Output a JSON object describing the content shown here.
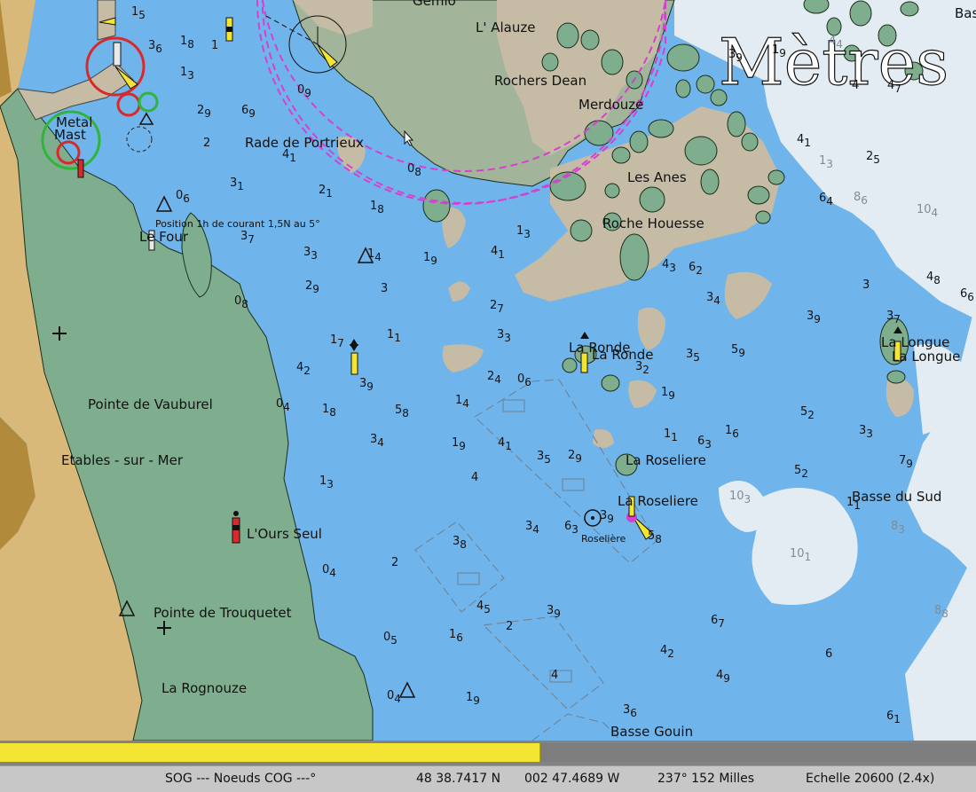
{
  "watermark": "Mètres",
  "places": {
    "gemlo": "Gemlo",
    "alauze": "L' Alauze",
    "rochers_dean": "Rochers Dean",
    "merdouze": "Merdouze",
    "rade": "Rade de Portrieux",
    "les_anes": "Les Anes",
    "roche_houesse": "Roche Houesse",
    "metal_mast_1": "Metal",
    "metal_mast_2": "Mast",
    "le_four": "Le Four",
    "courant": "Position 1h de courant 1,5N au 5°",
    "la_ronde_a": "La Ronde",
    "la_ronde_b": "La Ronde",
    "la_longue_a": "La Longue",
    "la_longue_b": "La Longue",
    "vauburel": "Pointe de Vauburel",
    "etables": "Etables - sur - Mer",
    "roseliere_a": "La Roseliere",
    "roseliere_b": "La Roseliere",
    "roseliere_buoy": "Roselière",
    "basse_du_sud": "Basse du Sud",
    "ours_seul": "L'Ours Seul",
    "trouquetet": "Pointe de Trouquetet",
    "rognouze": "La Rognouze",
    "basse_gouin": "Basse Gouin",
    "bas": "Bas"
  },
  "soundings": [
    {
      "t": "15"
    },
    {
      "t": "36"
    },
    {
      "t": "18"
    },
    {
      "t": "1"
    },
    {
      "t": "13"
    },
    {
      "t": "29"
    },
    {
      "t": "69"
    },
    {
      "t": "2"
    },
    {
      "t": "09"
    },
    {
      "t": "41"
    },
    {
      "t": "31"
    },
    {
      "t": "06"
    },
    {
      "t": "21"
    },
    {
      "t": "18"
    },
    {
      "t": "08"
    },
    {
      "t": "37"
    },
    {
      "t": "33"
    },
    {
      "t": "14"
    },
    {
      "t": "19"
    },
    {
      "t": "41"
    },
    {
      "t": "13"
    },
    {
      "t": "29"
    },
    {
      "t": "3"
    },
    {
      "t": "08"
    },
    {
      "t": "27"
    },
    {
      "t": "33"
    },
    {
      "t": "17"
    },
    {
      "t": "11"
    },
    {
      "t": "42"
    },
    {
      "t": "39"
    },
    {
      "t": "24"
    },
    {
      "t": "06"
    },
    {
      "t": "04"
    },
    {
      "t": "18"
    },
    {
      "t": "58"
    },
    {
      "t": "14"
    },
    {
      "t": "34"
    },
    {
      "t": "19"
    },
    {
      "t": "41"
    },
    {
      "t": "4"
    },
    {
      "t": "35"
    },
    {
      "t": "29"
    },
    {
      "t": "13"
    },
    {
      "t": "34"
    },
    {
      "t": "63"
    },
    {
      "t": "39"
    },
    {
      "t": "2"
    },
    {
      "t": "04"
    },
    {
      "t": "38"
    },
    {
      "t": "45"
    },
    {
      "t": "05"
    },
    {
      "t": "16"
    },
    {
      "t": "2"
    },
    {
      "t": "39"
    },
    {
      "t": "4"
    },
    {
      "t": "04"
    },
    {
      "t": "19"
    },
    {
      "t": "36"
    },
    {
      "t": "43"
    },
    {
      "t": "62"
    },
    {
      "t": "34"
    },
    {
      "t": "35"
    },
    {
      "t": "59"
    },
    {
      "t": "32"
    },
    {
      "t": "19"
    },
    {
      "t": "11"
    },
    {
      "t": "63"
    },
    {
      "t": "16"
    },
    {
      "t": "58"
    },
    {
      "t": "67"
    },
    {
      "t": "42"
    },
    {
      "t": "49"
    },
    {
      "t": "6"
    },
    {
      "t": "61"
    },
    {
      "t": "41"
    },
    {
      "t": "25"
    },
    {
      "t": "64"
    },
    {
      "t": "3"
    },
    {
      "t": "48"
    },
    {
      "t": "66"
    },
    {
      "t": "39"
    },
    {
      "t": "37"
    },
    {
      "t": "52"
    },
    {
      "t": "33"
    },
    {
      "t": "79"
    },
    {
      "t": "52"
    },
    {
      "t": "11"
    },
    {
      "t": "39"
    },
    {
      "t": "19"
    },
    {
      "t": "4"
    },
    {
      "t": "47"
    }
  ],
  "soundings_pale": [
    {
      "t": "13"
    },
    {
      "t": "86"
    },
    {
      "t": "104"
    },
    {
      "t": "103"
    },
    {
      "t": "101"
    },
    {
      "t": "83"
    },
    {
      "t": "88"
    },
    {
      "t": "44"
    }
  ],
  "status": {
    "sog_cog": "SOG --- Noeuds COG ---°",
    "lat": "48 38.7417 N",
    "lon": "002 47.4689 W",
    "bearing_dist": "237°  152 Milles",
    "scale": "Echelle 20600 (2.4x)"
  },
  "progress": {
    "value": 0.553
  },
  "colors": {
    "sea_shallow": "#6fb4ea",
    "sea_deep": "#e2ecf2",
    "land": "#a2b49a",
    "foreshore": "#7fae8e",
    "rock": "#c6bca6",
    "land_dry": "#d9b97a",
    "progress": "#f3e532"
  },
  "icons": [
    "light-beacon-icon",
    "topmark-triangle-icon",
    "cross-icon",
    "buoy-icon",
    "sector-light-icon",
    "cursor-arrow-icon"
  ]
}
